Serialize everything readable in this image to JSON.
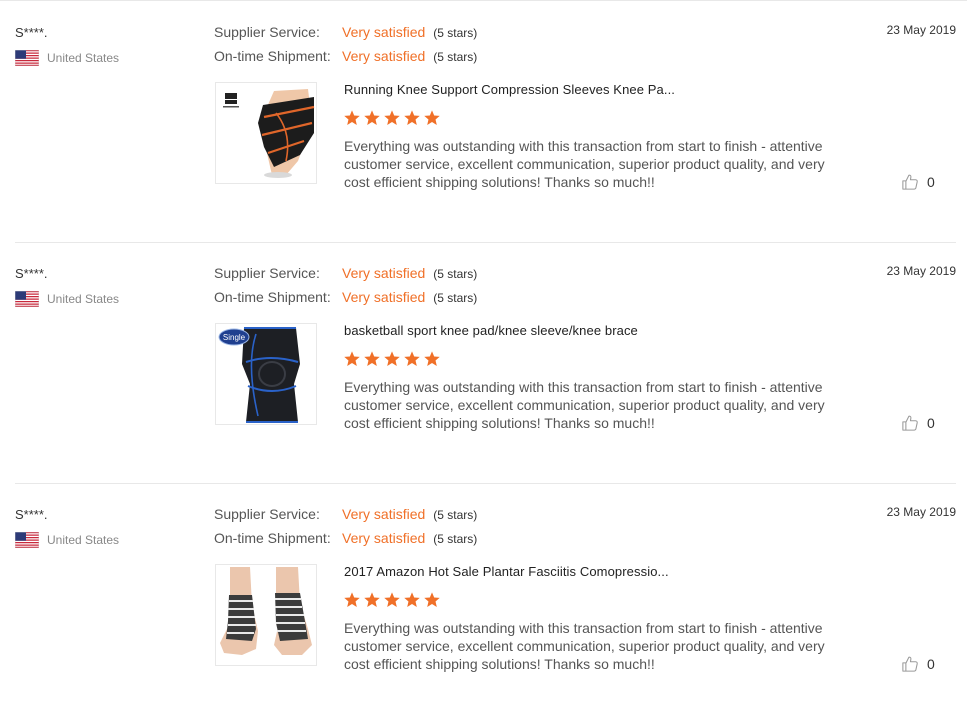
{
  "labels": {
    "supplier_service": "Supplier Service:",
    "ontime_shipment": "On-time Shipment:"
  },
  "colors": {
    "rating_orange": "#f07028",
    "divider": "#e8e8e8"
  },
  "icons": {
    "flag": "us-flag-icon",
    "star": "star-icon",
    "helpful": "thumbs-up-icon"
  },
  "reviews": [
    {
      "buyer": "S****.",
      "country": "United States",
      "supplier_service": "Very satisfied",
      "supplier_service_stars": "(5 stars)",
      "ontime_shipment": "Very satisfied",
      "ontime_shipment_stars": "(5 stars)",
      "date": "23 May 2019",
      "product_title": "Running Knee Support Compression Sleeves Knee Pa...",
      "rating": 5,
      "text": "Everything was outstanding with this transaction from start to finish - attentive customer service, excellent communication, superior product quality, and very cost efficient shipping solutions! Thanks so much!!",
      "helpful_count": "0"
    },
    {
      "buyer": "S****.",
      "country": "United States",
      "supplier_service": "Very satisfied",
      "supplier_service_stars": "(5 stars)",
      "ontime_shipment": "Very satisfied",
      "ontime_shipment_stars": "(5 stars)",
      "date": "23 May 2019",
      "product_title": "basketball sport knee pad/knee sleeve/knee brace",
      "product_badge": "Single",
      "rating": 5,
      "text": "Everything was outstanding with this transaction from start to finish - attentive customer service, excellent communication, superior product quality, and very cost efficient shipping solutions! Thanks so much!!",
      "helpful_count": "0"
    },
    {
      "buyer": "S****.",
      "country": "United States",
      "supplier_service": "Very satisfied",
      "supplier_service_stars": "(5 stars)",
      "ontime_shipment": "Very satisfied",
      "ontime_shipment_stars": "(5 stars)",
      "date": "23 May 2019",
      "product_title": "2017 Amazon Hot Sale Plantar Fasciitis Comopressio...",
      "rating": 5,
      "text": "Everything was outstanding with this transaction from start to finish - attentive customer service, excellent communication, superior product quality, and very cost efficient shipping solutions! Thanks so much!!",
      "helpful_count": "0"
    }
  ]
}
